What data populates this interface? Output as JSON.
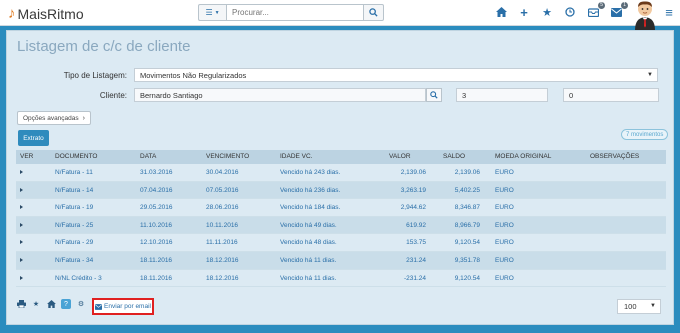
{
  "app": {
    "name": "MaisRitmo"
  },
  "search": {
    "placeholder": "Procurar..."
  },
  "topbar": {
    "badges": {
      "messages": "5",
      "mail": "1"
    }
  },
  "page": {
    "title": "Listagem de c/c de cliente"
  },
  "form": {
    "tipo_label": "Tipo de Listagem:",
    "tipo_value": "Movimentos Não Regularizados",
    "cliente_label": "Cliente:",
    "cliente_value": "Bernardo Santiago",
    "cliente_code": "3",
    "cliente_extra": "0"
  },
  "buttons": {
    "advanced": "Opções avançadas",
    "extrato": "Extrato",
    "email": "Enviar por email"
  },
  "count_badge": "7 movimentos",
  "table": {
    "headers": [
      "VER",
      "DOCUMENTO",
      "DATA",
      "VENCIMENTO",
      "IDADE VC.",
      "VALOR",
      "SALDO",
      "MOEDA ORIGINAL",
      "OBSERVAÇÕES"
    ],
    "rows": [
      {
        "doc": "N/Fatura - 11",
        "data": "31.03.2016",
        "venc": "30.04.2016",
        "idade": "Vencido há 243 dias.",
        "valor": "2,139.06",
        "saldo": "2,139.06",
        "moeda": "EURO",
        "obs": ""
      },
      {
        "doc": "N/Fatura - 14",
        "data": "07.04.2016",
        "venc": "07.05.2016",
        "idade": "Vencido há 236 dias.",
        "valor": "3,263.19",
        "saldo": "5,402.25",
        "moeda": "EURO",
        "obs": ""
      },
      {
        "doc": "N/Fatura - 19",
        "data": "29.05.2016",
        "venc": "28.06.2016",
        "idade": "Vencido há 184 dias.",
        "valor": "2,944.62",
        "saldo": "8,346.87",
        "moeda": "EURO",
        "obs": ""
      },
      {
        "doc": "N/Fatura - 25",
        "data": "11.10.2016",
        "venc": "10.11.2016",
        "idade": "Vencido há 49 dias.",
        "valor": "619.92",
        "saldo": "8,966.79",
        "moeda": "EURO",
        "obs": ""
      },
      {
        "doc": "N/Fatura - 29",
        "data": "12.10.2016",
        "venc": "11.11.2016",
        "idade": "Vencido há 48 dias.",
        "valor": "153.75",
        "saldo": "9,120.54",
        "moeda": "EURO",
        "obs": ""
      },
      {
        "doc": "N/Fatura - 34",
        "data": "18.11.2016",
        "venc": "18.12.2016",
        "idade": "Vencido há 11 dias.",
        "valor": "231.24",
        "saldo": "9,351.78",
        "moeda": "EURO",
        "obs": ""
      },
      {
        "doc": "N/NL Crédito - 3",
        "data": "18.11.2016",
        "venc": "18.12.2016",
        "idade": "Vencido há 11 dias.",
        "valor": "-231.24",
        "saldo": "9,120.54",
        "moeda": "EURO",
        "obs": ""
      }
    ]
  },
  "pagination": {
    "per_page": "100"
  }
}
